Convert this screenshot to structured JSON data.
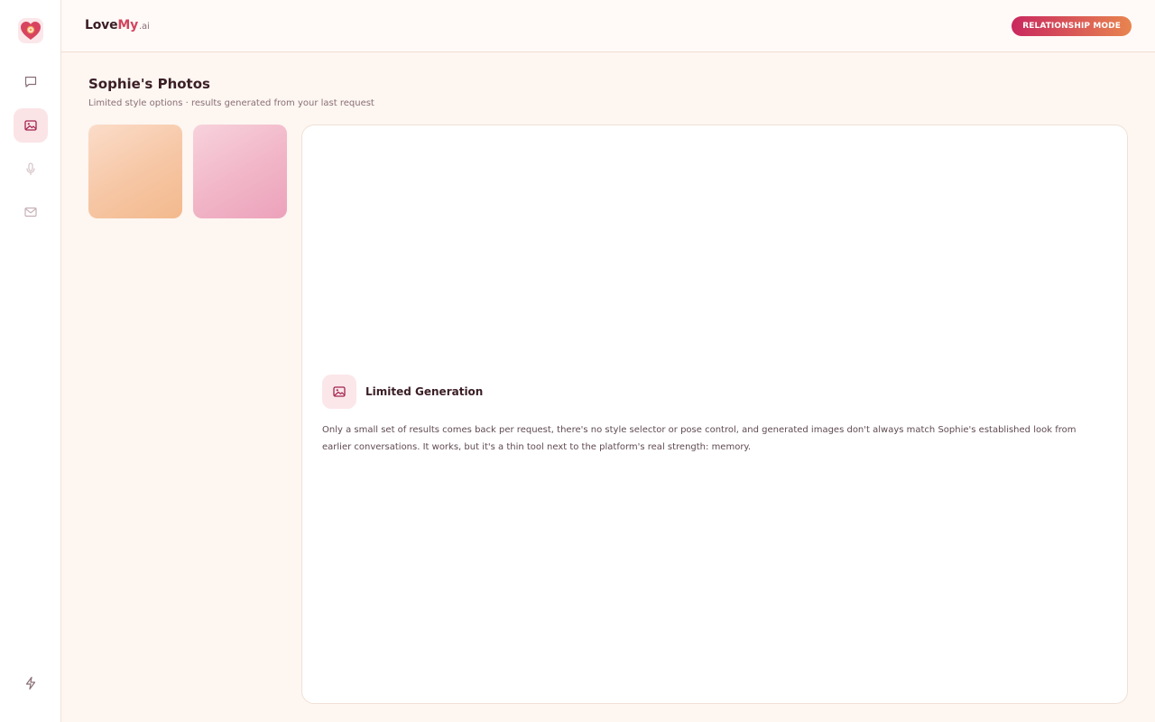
{
  "brand": {
    "love": "Love",
    "my": "My",
    "ai": ".ai"
  },
  "header": {
    "mode_label": "RELATIONSHIP MODE"
  },
  "sidebar": {
    "items": [
      {
        "name": "chat",
        "icon": "chat-bubble-icon"
      },
      {
        "name": "photos",
        "icon": "image-icon",
        "active": true
      },
      {
        "name": "voice",
        "icon": "microphone-icon"
      },
      {
        "name": "messages",
        "icon": "mail-icon"
      }
    ],
    "bottom_icon": "lightning-icon"
  },
  "main": {
    "title": "Sophie's Photos",
    "subtitle": "Limited style options · results generated from your last request",
    "thumbnails": [
      {
        "id": "thumb-1",
        "color": "#f6c6a4"
      },
      {
        "id": "thumb-2",
        "color": "#f1b5c7"
      }
    ],
    "panel": {
      "heading": "Limited Generation",
      "body": "Only a small set of results comes back per request, there's no style selector or pose control, and generated images don't always match Sophie's established look from earlier conversations. It works, but it's a thin tool next to the platform's real strength: memory."
    }
  },
  "colors": {
    "accent": "#d2455e",
    "pill_start": "#c9285f",
    "pill_end": "#e8854f",
    "background": "#fdf6f1"
  }
}
